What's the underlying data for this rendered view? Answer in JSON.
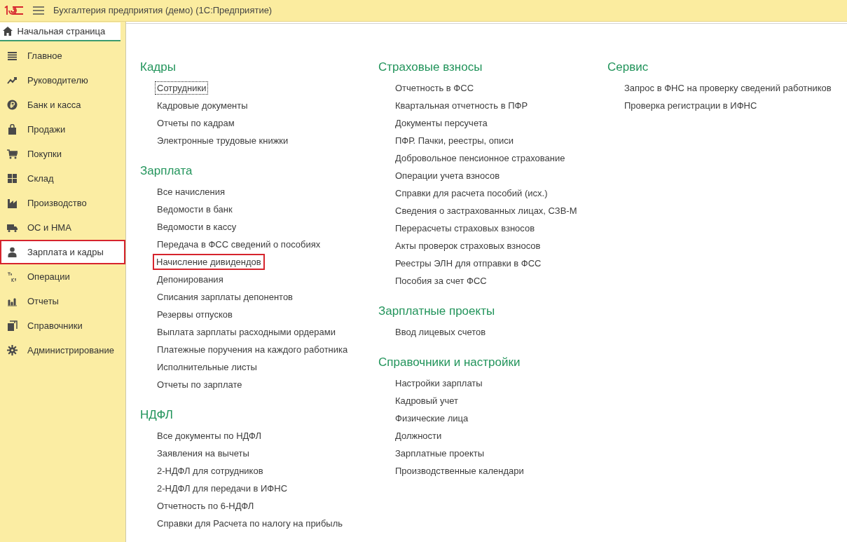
{
  "window": {
    "title": "Бухгалтерия предприятия (демо)  (1С:Предприятие)"
  },
  "home_tab": {
    "label": "Начальная страница",
    "selected": true
  },
  "sidebar": {
    "items": [
      {
        "label": "Главное",
        "selected": false
      },
      {
        "label": "Руководителю",
        "selected": false
      },
      {
        "label": "Банк и касса",
        "selected": false
      },
      {
        "label": "Продажи",
        "selected": false
      },
      {
        "label": "Покупки",
        "selected": false
      },
      {
        "label": "Склад",
        "selected": false
      },
      {
        "label": "Производство",
        "selected": false
      },
      {
        "label": "ОС и НМА",
        "selected": false
      },
      {
        "label": "Зарплата и кадры",
        "selected": true
      },
      {
        "label": "Операции",
        "selected": false
      },
      {
        "label": "Отчеты",
        "selected": false
      },
      {
        "label": "Справочники",
        "selected": false
      },
      {
        "label": "Администрирование",
        "selected": false
      }
    ]
  },
  "columns": [
    [
      {
        "title": "Кадры",
        "items": [
          {
            "label": "Сотрудники",
            "kind": "focused"
          },
          {
            "label": "Кадровые документы",
            "kind": "plain"
          },
          {
            "label": "Отчеты по кадрам",
            "kind": "plain"
          },
          {
            "label": "Электронные трудовые книжки",
            "kind": "plain"
          }
        ]
      },
      {
        "title": "Зарплата",
        "items": [
          {
            "label": "Все начисления",
            "kind": "plain"
          },
          {
            "label": "Ведомости в банк",
            "kind": "plain"
          },
          {
            "label": "Ведомости в кассу",
            "kind": "plain"
          },
          {
            "label": "Передача в ФСС сведений о пособиях",
            "kind": "plain"
          },
          {
            "label": "Начисление дивидендов",
            "kind": "boxed"
          },
          {
            "label": "Депонирования",
            "kind": "plain"
          },
          {
            "label": "Списания зарплаты депонентов",
            "kind": "plain"
          },
          {
            "label": "Резервы отпусков",
            "kind": "plain"
          },
          {
            "label": "Выплата зарплаты расходными ордерами",
            "kind": "plain"
          },
          {
            "label": "Платежные поручения на каждого работника",
            "kind": "plain"
          },
          {
            "label": "Исполнительные листы",
            "kind": "plain"
          },
          {
            "label": "Отчеты по зарплате",
            "kind": "plain"
          }
        ]
      },
      {
        "title": "НДФЛ",
        "items": [
          {
            "label": "Все документы по НДФЛ",
            "kind": "plain"
          },
          {
            "label": "Заявления на вычеты",
            "kind": "plain"
          },
          {
            "label": "2-НДФЛ для сотрудников",
            "kind": "plain"
          },
          {
            "label": "2-НДФЛ для передачи в ИФНС",
            "kind": "plain"
          },
          {
            "label": "Отчетность по 6-НДФЛ",
            "kind": "plain"
          },
          {
            "label": "Справки для Расчета по налогу на прибыль",
            "kind": "plain"
          }
        ]
      }
    ],
    [
      {
        "title": "Страховые взносы",
        "items": [
          {
            "label": "Отчетность в ФСС",
            "kind": "plain"
          },
          {
            "label": "Квартальная отчетность в ПФР",
            "kind": "plain"
          },
          {
            "label": "Документы персучета",
            "kind": "plain"
          },
          {
            "label": "ПФР. Пачки, реестры, описи",
            "kind": "plain"
          },
          {
            "label": "Добровольное пенсионное страхование",
            "kind": "plain"
          },
          {
            "label": "Операции учета взносов",
            "kind": "plain"
          },
          {
            "label": "Справки для расчета пособий (исх.)",
            "kind": "plain"
          },
          {
            "label": "Сведения о застрахованных лицах, СЗВ-М",
            "kind": "plain"
          },
          {
            "label": "Перерасчеты страховых взносов",
            "kind": "plain"
          },
          {
            "label": "Акты проверок страховых взносов",
            "kind": "plain"
          },
          {
            "label": "Реестры ЭЛН для отправки в ФСС",
            "kind": "plain"
          },
          {
            "label": "Пособия за счет ФСС",
            "kind": "plain"
          }
        ]
      },
      {
        "title": "Зарплатные проекты",
        "items": [
          {
            "label": "Ввод лицевых счетов",
            "kind": "plain"
          }
        ]
      },
      {
        "title": "Справочники и настройки",
        "items": [
          {
            "label": "Настройки зарплаты",
            "kind": "plain"
          },
          {
            "label": "Кадровый учет",
            "kind": "plain"
          },
          {
            "label": "Физические лица",
            "kind": "plain"
          },
          {
            "label": "Должности",
            "kind": "plain"
          },
          {
            "label": "Зарплатные проекты",
            "kind": "plain"
          },
          {
            "label": "Производственные календари",
            "kind": "plain"
          }
        ]
      }
    ],
    [
      {
        "title": "Сервис",
        "items": [
          {
            "label": "Запрос в ФНС на проверку сведений работников",
            "kind": "plain"
          },
          {
            "label": "Проверка регистрации в ИФНС",
            "kind": "plain"
          }
        ]
      }
    ]
  ]
}
